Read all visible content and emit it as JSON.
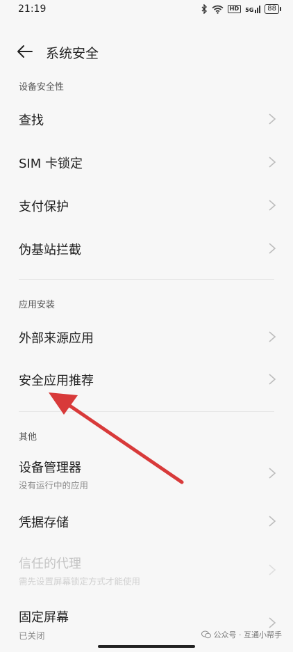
{
  "status_bar": {
    "time": "21:19",
    "network_badge": "HD",
    "signal_label": "5G",
    "battery_level": "88",
    "icons": [
      "bluetooth-icon",
      "wifi-icon",
      "hd-icon",
      "signal-icon",
      "battery-icon"
    ]
  },
  "header": {
    "back_icon": "arrow-left-icon",
    "title": "系统安全"
  },
  "sections": {
    "device_security": {
      "title": "设备安全性",
      "items": [
        {
          "label": "查找"
        },
        {
          "label": "SIM 卡锁定"
        },
        {
          "label": "支付保护"
        },
        {
          "label": "伪基站拦截"
        }
      ]
    },
    "app_install": {
      "title": "应用安装",
      "items": [
        {
          "label": "外部来源应用"
        },
        {
          "label": "安全应用推荐"
        }
      ]
    },
    "other": {
      "title": "其他",
      "items": [
        {
          "label": "设备管理器",
          "subtitle": "没有运行中的应用"
        },
        {
          "label": "凭据存储"
        },
        {
          "label": "信任的代理",
          "subtitle": "需先设置屏幕锁定方式才能使用",
          "disabled": true
        },
        {
          "label": "固定屏幕",
          "subtitle": "已关闭"
        }
      ]
    }
  },
  "annotation": {
    "color": "#d83a3a",
    "icon": "red-arrow"
  },
  "watermark": {
    "text": "公众号 · 互通小帮手",
    "icon": "wechat-icon"
  }
}
